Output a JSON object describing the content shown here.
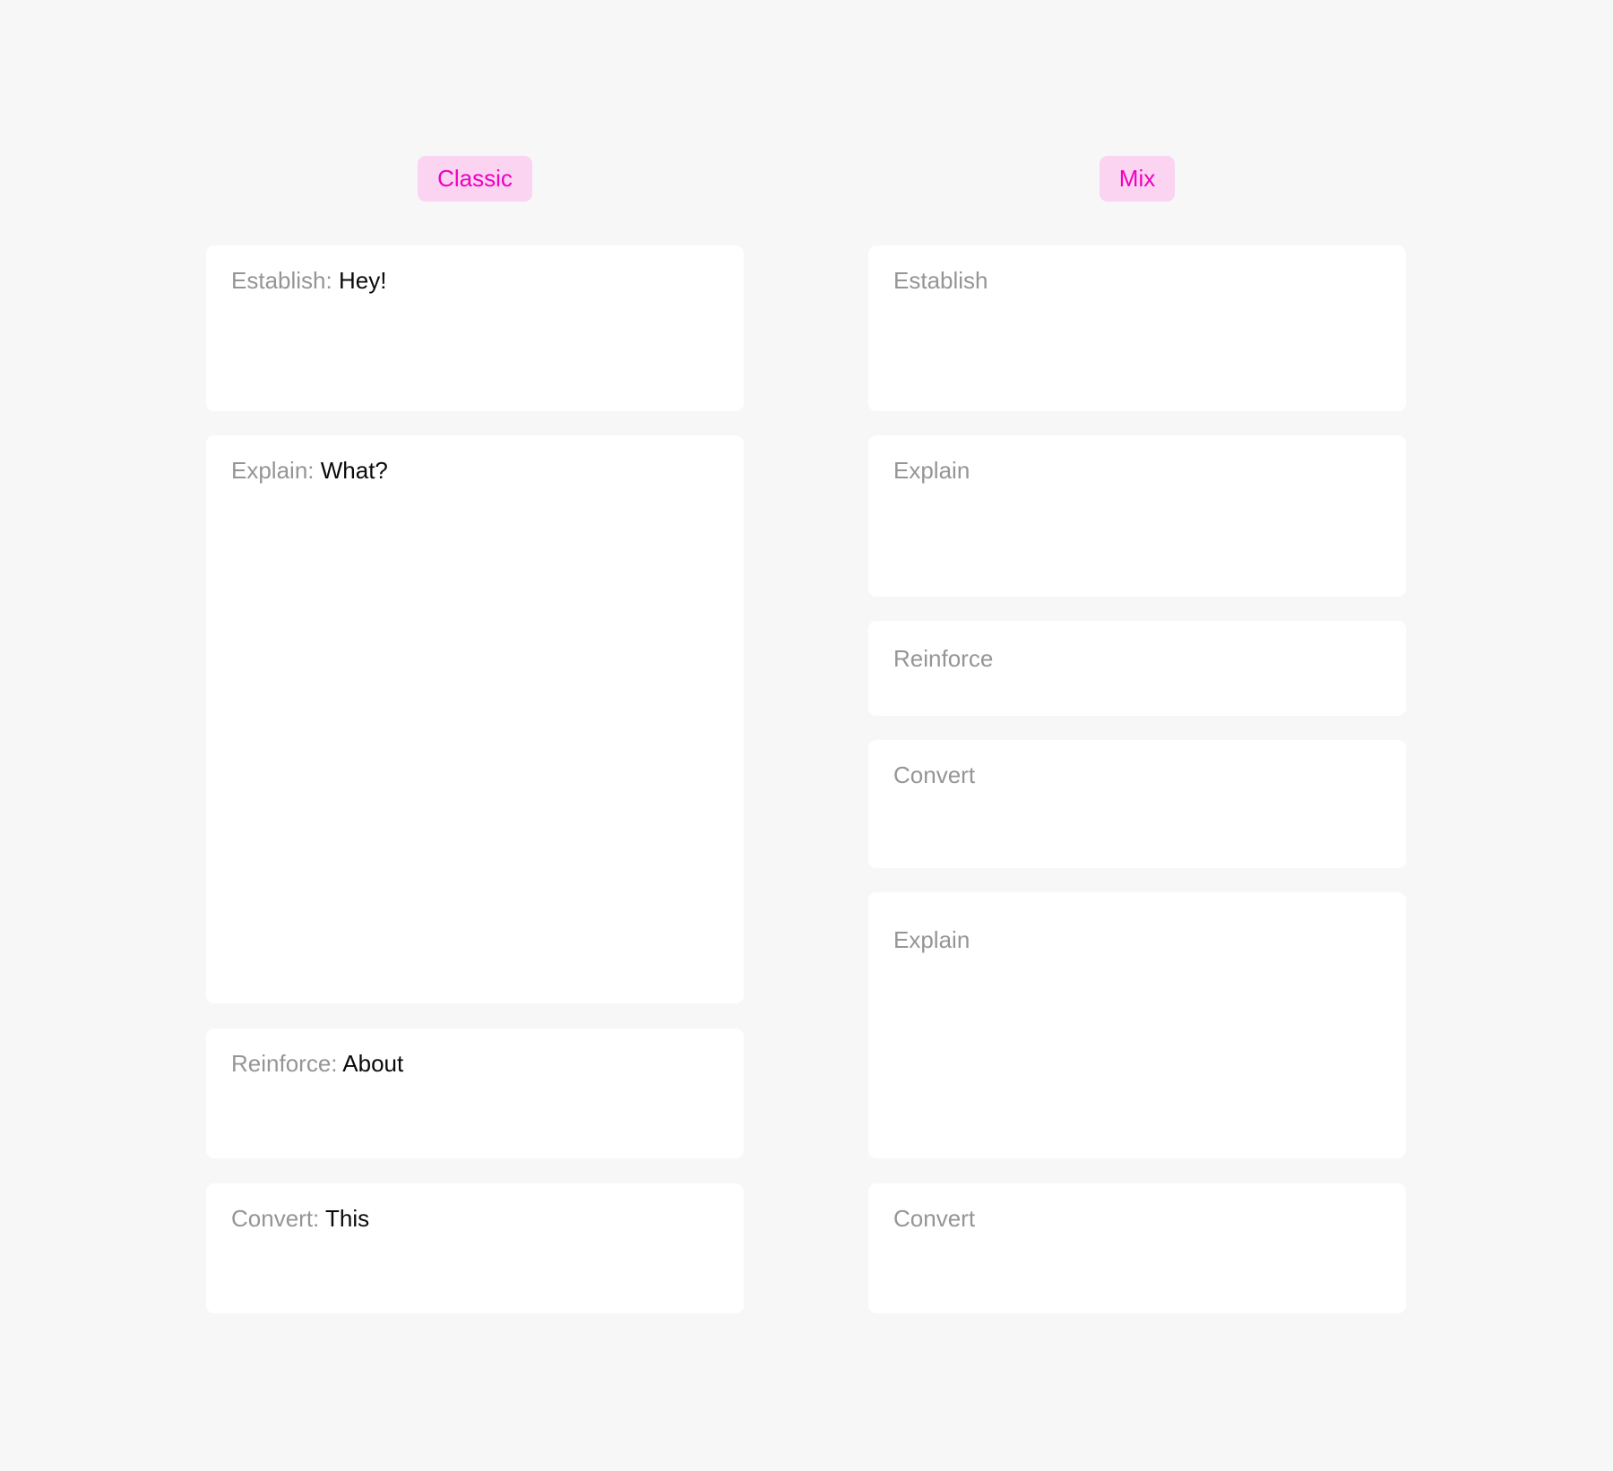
{
  "columns": [
    {
      "title": "Classic",
      "cards": [
        {
          "label": "Establish:",
          "value": "Hey!"
        },
        {
          "label": "Explain:",
          "value": "What?"
        },
        {
          "label": "Reinforce:",
          "value": "About"
        },
        {
          "label": "Convert:",
          "value": "This"
        }
      ]
    },
    {
      "title": "Mix",
      "cards": [
        {
          "label": "Establish"
        },
        {
          "label": "Explain"
        },
        {
          "label": "Reinforce"
        },
        {
          "label": "Convert"
        },
        {
          "label": "Explain"
        },
        {
          "label": "Convert"
        }
      ]
    }
  ],
  "colors": {
    "badge_background": "#fad4f1",
    "badge_text": "#f000c0",
    "page_background": "#f7f7f7",
    "card_background": "#ffffff",
    "label_text": "#959595",
    "value_text": "#0a0a0a"
  }
}
